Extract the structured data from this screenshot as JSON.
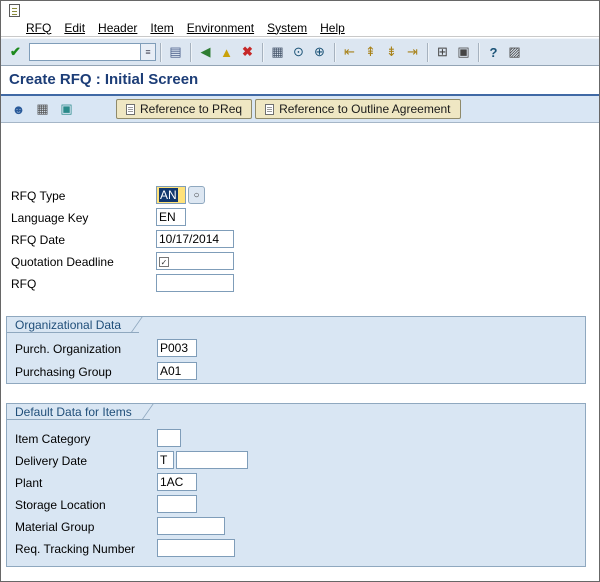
{
  "titlebar": {
    "title": "Create RFQ : Initial Screen"
  },
  "menu": {
    "items": [
      "RFQ",
      "Edit",
      "Header",
      "Item",
      "Environment",
      "System",
      "Help"
    ]
  },
  "toolbar": {
    "enter_icon": "✔",
    "command_field_value": "",
    "history_icon": "≡",
    "icons": [
      {
        "name": "save",
        "glyph": "▤"
      },
      {
        "name": "back",
        "glyph": "◀"
      },
      {
        "name": "exit",
        "glyph": "▲"
      },
      {
        "name": "cancel",
        "glyph": "✖"
      },
      {
        "name": "print",
        "glyph": "▦"
      },
      {
        "name": "find",
        "glyph": "⊙"
      },
      {
        "name": "find-next",
        "glyph": "⊕"
      },
      {
        "name": "first-page",
        "glyph": "⇤"
      },
      {
        "name": "previous-page",
        "glyph": "⇞"
      },
      {
        "name": "next-page",
        "glyph": "⇟"
      },
      {
        "name": "last-page",
        "glyph": "⇥"
      },
      {
        "name": "new-session",
        "glyph": "⊞"
      },
      {
        "name": "create-shortcut",
        "glyph": "▣"
      },
      {
        "name": "help",
        "glyph": "?"
      },
      {
        "name": "customize-layout",
        "glyph": "▨"
      }
    ]
  },
  "app_toolbar": {
    "icons": [
      {
        "name": "user",
        "glyph": "☻"
      },
      {
        "name": "printer",
        "glyph": "▦"
      },
      {
        "name": "copy",
        "glyph": "▣"
      }
    ],
    "buttons": [
      "Reference to PReq",
      "Reference to Outline Agreement"
    ]
  },
  "form": {
    "rfq_type": {
      "label": "RFQ Type",
      "value": "AN",
      "matchcode_icon": "○"
    },
    "language_key": {
      "label": "Language Key",
      "value": "EN"
    },
    "rfq_date": {
      "label": "RFQ Date",
      "value": "10/17/2014"
    },
    "quotation_deadline": {
      "label": "Quotation Deadline",
      "value": "",
      "required_mark": "✓"
    },
    "rfq": {
      "label": "RFQ",
      "value": ""
    }
  },
  "organizational_data": {
    "title": "Organizational Data",
    "purch_organization": {
      "label": "Purch. Organization",
      "value": "P003"
    },
    "purchasing_group": {
      "label": "Purchasing Group",
      "value": "A01"
    }
  },
  "default_data_for_items": {
    "title": "Default Data for Items",
    "item_category": {
      "label": "Item Category",
      "value": ""
    },
    "delivery_date": {
      "label": "Delivery Date",
      "date_category_value": "T",
      "date_value": ""
    },
    "plant": {
      "label": "Plant",
      "value": "1AC"
    },
    "storage_location": {
      "label": "Storage Location",
      "value": ""
    },
    "material_group": {
      "label": "Material Group",
      "value": ""
    },
    "req_tracking_number": {
      "label": "Req. Tracking Number",
      "value": ""
    }
  },
  "colors": {
    "title_text": "#1c3d77",
    "toolbar_bg": "#dce6f1",
    "group_bg": "#d9e6f3",
    "focused_field_bg": "#ffe27a",
    "selection_bg": "#12386e",
    "reference_button_bg": "#efe7c3"
  }
}
